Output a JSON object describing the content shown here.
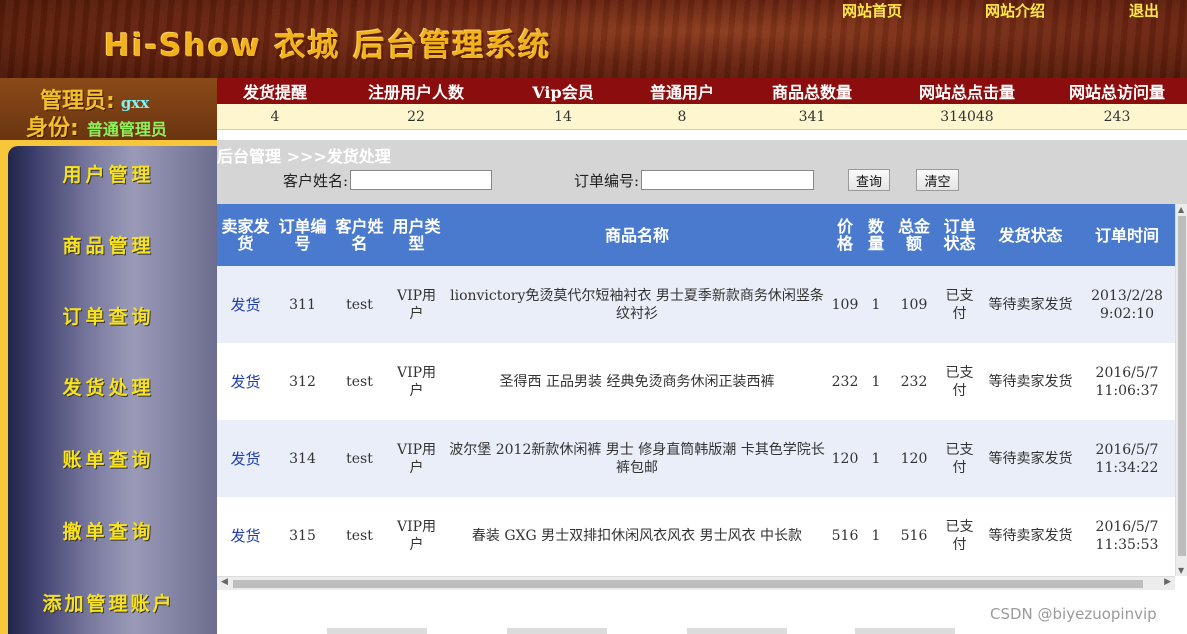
{
  "header": {
    "logo": "Hi-Show 衣城 后台管理系统",
    "nav": [
      "网站首页",
      "网站介绍",
      "退出"
    ]
  },
  "admin": {
    "label_name": "管理员:",
    "name": "gxx",
    "label_role": "身份:",
    "role": "普通管理员"
  },
  "stats": {
    "headers": [
      "发货提醒",
      "注册用户人数",
      "Vip会员",
      "普通用户",
      "商品总数量",
      "网站总点击量",
      "网站总访问量"
    ],
    "values": [
      "4",
      "22",
      "14",
      "8",
      "341",
      "314048",
      "243"
    ]
  },
  "sidebar": {
    "items": [
      "用户管理",
      "商品管理",
      "订单查询",
      "发货处理",
      "账单查询",
      "撤单查询",
      "添加管理账户"
    ]
  },
  "main": {
    "breadcrumb": "后台管理 >>>发货处理",
    "search": {
      "customer_label": "客户姓名:",
      "customer_value": "",
      "order_label": "订单编号:",
      "order_value": "",
      "query_button": "查询",
      "clear_button": "清空"
    },
    "table": {
      "headers": [
        "卖家发货",
        "订单编号",
        "客户姓名",
        "用户类型",
        "商品名称",
        "价格",
        "数量",
        "总金额",
        "订单状态",
        "发货状态",
        "订单时间"
      ],
      "rows": [
        [
          "发货",
          "311",
          "test",
          "VIP用户",
          "lionvictory免烫莫代尔短袖衬衣 男士夏季新款商务休闲竖条纹衬衫",
          "109",
          "1",
          "109",
          "已支付",
          "等待卖家发货",
          "2013/2/28 9:02:10"
        ],
        [
          "发货",
          "312",
          "test",
          "VIP用户",
          "圣得西 正品男装 经典免烫商务休闲正装西裤",
          "232",
          "1",
          "232",
          "已支付",
          "等待卖家发货",
          "2016/5/7 11:06:37"
        ],
        [
          "发货",
          "314",
          "test",
          "VIP用户",
          "波尔堡 2012新款休闲裤 男士 修身直筒韩版潮 卡其色学院长裤包邮",
          "120",
          "1",
          "120",
          "已支付",
          "等待卖家发货",
          "2016/5/7 11:34:22"
        ],
        [
          "发货",
          "315",
          "test",
          "VIP用户",
          "春装 GXG 男士双排扣休闲风衣风衣 男士风衣 中长款",
          "516",
          "1",
          "516",
          "已支付",
          "等待卖家发货",
          "2016/5/7 11:35:53"
        ]
      ]
    }
  },
  "watermark": "CSDN @biyezuopinvip",
  "colors": {
    "stats_header_bg": "#8b0d0d",
    "table_header_bg": "#4a7acd",
    "sidebar_text": "#f7e21c",
    "logo_text": "#f2b21c"
  }
}
